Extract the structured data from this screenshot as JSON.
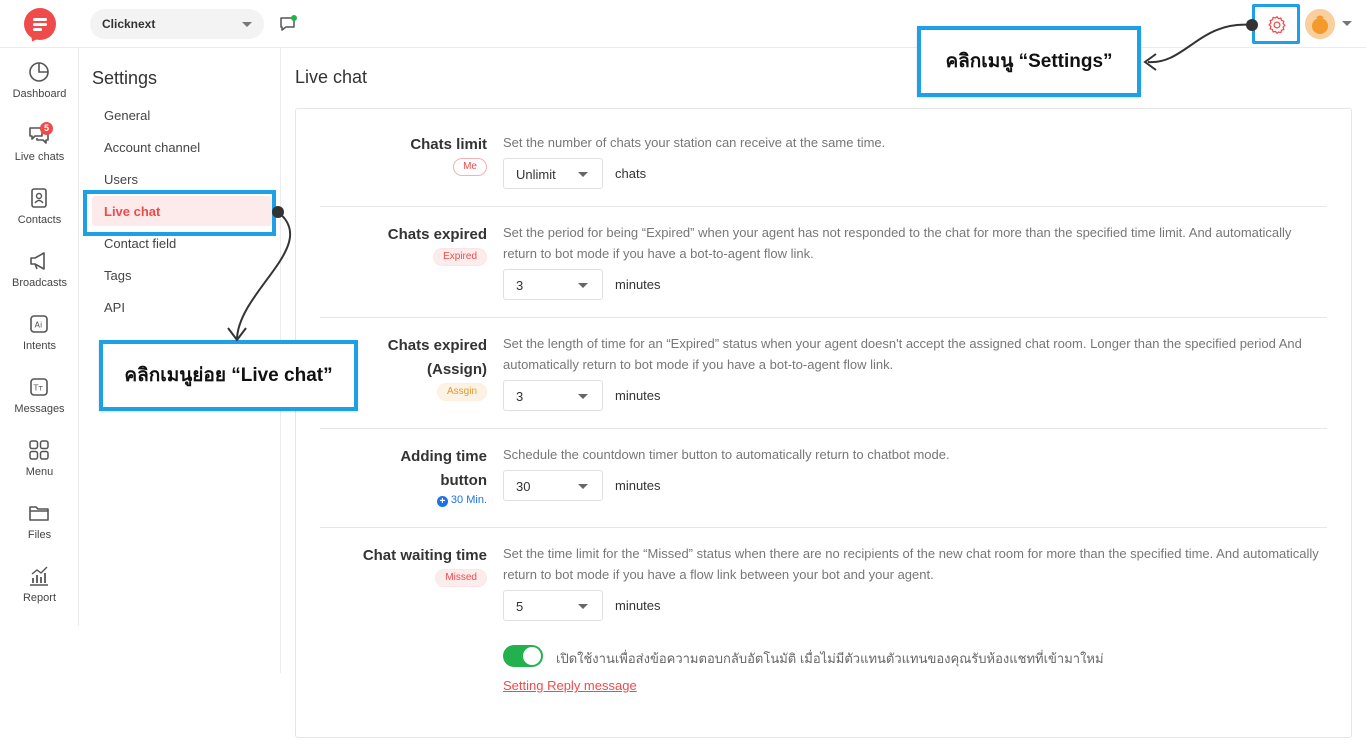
{
  "topbar": {
    "workspace": "Clicknext"
  },
  "leftnav": {
    "items": [
      {
        "label": "Dashboard"
      },
      {
        "label": "Live chats",
        "badge": "5"
      },
      {
        "label": "Contacts"
      },
      {
        "label": "Broadcasts"
      },
      {
        "label": "Intents"
      },
      {
        "label": "Messages"
      },
      {
        "label": "Menu"
      },
      {
        "label": "Files"
      },
      {
        "label": "Report"
      }
    ]
  },
  "settings": {
    "title": "Settings",
    "items": [
      {
        "label": "General"
      },
      {
        "label": "Account channel"
      },
      {
        "label": "Users"
      },
      {
        "label": "Live chat"
      },
      {
        "label": "Contact field"
      },
      {
        "label": "Tags"
      },
      {
        "label": "API"
      }
    ]
  },
  "main": {
    "title": "Live chat",
    "rows": [
      {
        "label": "Chats limit",
        "tag": "Me",
        "description": "Set the number of chats your station can receive at the same time.",
        "value": "Unlimit",
        "unit": "chats"
      },
      {
        "label": "Chats expired",
        "tag": "Expired",
        "description": "Set the period for being “Expired” when your agent has not responded to the chat for more than the specified time limit. And automatically return to bot mode if you have a bot-to-agent flow link.",
        "value": "3",
        "unit": "minutes"
      },
      {
        "label_line1": "Chats expired",
        "label_line2": "(Assign)",
        "tag": "Assgin",
        "description": "Set the length of time for an “Expired” status when your agent doesn't accept the assigned chat room. Longer than the specified period And automatically return to bot mode if you have a bot-to-agent flow link.",
        "value": "3",
        "unit": "minutes"
      },
      {
        "label_line1": "Adding time",
        "label_line2": "button",
        "tag": "30 Min.",
        "description": "Schedule the countdown timer button to automatically return to chatbot mode.",
        "value": "30",
        "unit": "minutes"
      },
      {
        "label": "Chat waiting time",
        "tag": "Missed",
        "description": "Set the time limit for the “Missed” status when there are no recipients of the new chat room for more than the specified time. And automatically return to bot mode if you have a flow link between your bot and your agent.",
        "value": "5",
        "unit": "minutes"
      }
    ],
    "toggle_label": "เปิดใช้งานเพื่อส่งข้อความตอบกลับอัตโนมัติ เมื่อไม่มีตัวแทนตัวแทนของคุณรับห้องแชทที่เข้ามาใหม่",
    "toggle_on": true,
    "reply_link": "Setting Reply message"
  },
  "callouts": {
    "settings": "คลิกเมนู “Settings”",
    "livechat": "คลิกเมนูย่อย “Live chat”"
  },
  "colors": {
    "accent": "#ef4b4b",
    "callout_border": "#1ea0e6",
    "toggle_on": "#22b14c",
    "link_blue": "#1a73e8"
  }
}
